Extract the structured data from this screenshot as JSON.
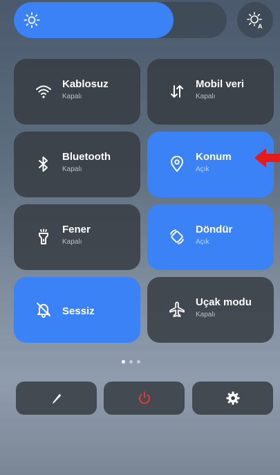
{
  "brightness": {
    "level": 0.75,
    "icon": "sun-icon",
    "auto_icon": "auto-brightness-icon"
  },
  "tiles": [
    {
      "title": "Kablosuz",
      "status": "Kapalı",
      "active": false,
      "icon": "wifi-icon"
    },
    {
      "title": "Mobil veri",
      "status": "Kapalı",
      "active": false,
      "icon": "mobile-data-icon"
    },
    {
      "title": "Bluetooth",
      "status": "Kapalı",
      "active": false,
      "icon": "bluetooth-icon"
    },
    {
      "title": "Konum",
      "status": "Açık",
      "active": true,
      "icon": "location-icon"
    },
    {
      "title": "Fener",
      "status": "Kapalı",
      "active": false,
      "icon": "flashlight-icon"
    },
    {
      "title": "Döndür",
      "status": "Açık",
      "active": true,
      "icon": "rotate-icon"
    },
    {
      "title": "Sessiz",
      "status": "",
      "active": true,
      "icon": "mute-bell-icon"
    },
    {
      "title": "Uçak modu",
      "status": "Kapalı",
      "active": false,
      "icon": "airplane-icon"
    }
  ],
  "pager": {
    "pages": 3,
    "current": 1
  },
  "bottom_buttons": [
    {
      "icon": "edit-pencil-icon"
    },
    {
      "icon": "power-icon"
    },
    {
      "icon": "settings-gear-icon"
    }
  ],
  "colors": {
    "accent": "#3b82f6",
    "tile_off": "#373c42",
    "power_red": "#e53935",
    "annotation_arrow": "#e31b1b"
  },
  "annotation": {
    "icon": "red-arrow-pointer-icon"
  }
}
